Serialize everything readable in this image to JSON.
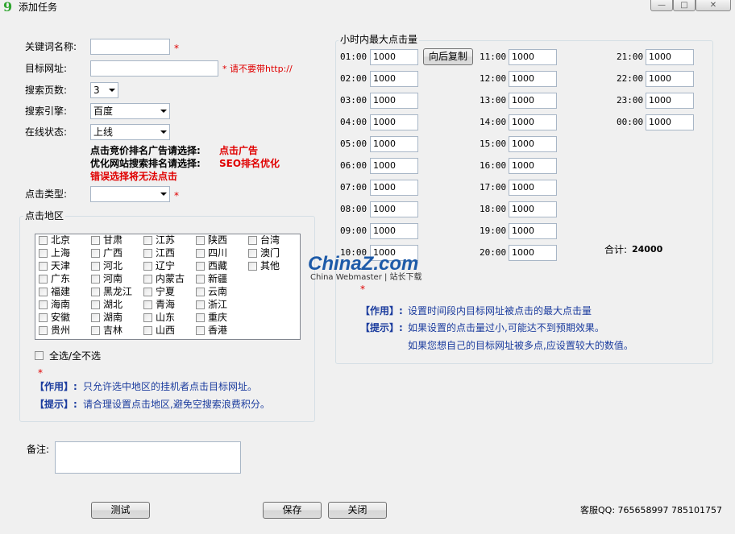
{
  "window": {
    "title": "添加任务",
    "app_icon_glyph": "9",
    "minimize_glyph": "—",
    "maximize_glyph": "□",
    "close_glyph": "✕"
  },
  "form": {
    "keyword_label": "关键词名称:",
    "keyword_value": "",
    "keyword_required": "*",
    "url_label": "目标网址:",
    "url_value": "",
    "url_hint": "* 请不要带http://",
    "pages_label": "搜索页数:",
    "pages_value": "3",
    "engine_label": "搜索引擎:",
    "engine_value": "百度",
    "status_label": "在线状态:",
    "status_value": "上线",
    "note1_prefix": "点击竞价排名广告请选择:",
    "note1_value": "点击广告",
    "note2_prefix": "优化网站搜索排名请选择:",
    "note2_value": "SEO排名优化",
    "note3": "错误选择将无法点击",
    "click_type_label": "点击类型:",
    "click_type_value": "",
    "click_type_required": "*"
  },
  "region": {
    "title": "点击地区",
    "columns": [
      [
        "北京",
        "上海",
        "天津",
        "广东",
        "福建",
        "海南",
        "安徽",
        "贵州"
      ],
      [
        "甘肃",
        "广西",
        "河北",
        "河南",
        "黑龙江",
        "湖北",
        "湖南",
        "吉林"
      ],
      [
        "江苏",
        "江西",
        "辽宁",
        "内蒙古",
        "宁夏",
        "青海",
        "山东",
        "山西"
      ],
      [
        "陕西",
        "四川",
        "西藏",
        "新疆",
        "云南",
        "浙江",
        "重庆",
        "香港"
      ],
      [
        "台湾",
        "澳门",
        "其他"
      ]
    ],
    "select_all_label": "全选/全不选",
    "required_mark": "*",
    "effect_tag": "【作用】:",
    "effect_text": "只允许选中地区的挂机者点击目标网址。",
    "tip_tag": "【提示】:",
    "tip_text": "请合理设置点击地区,避免空搜索浪费积分。"
  },
  "hourly": {
    "title": "小时内最大点击量",
    "copy_button": "向后复制",
    "hours": [
      {
        "time": "01:00",
        "value": "1000"
      },
      {
        "time": "02:00",
        "value": "1000"
      },
      {
        "time": "03:00",
        "value": "1000"
      },
      {
        "time": "04:00",
        "value": "1000"
      },
      {
        "time": "05:00",
        "value": "1000"
      },
      {
        "time": "06:00",
        "value": "1000"
      },
      {
        "time": "07:00",
        "value": "1000"
      },
      {
        "time": "08:00",
        "value": "1000"
      },
      {
        "time": "09:00",
        "value": "1000"
      },
      {
        "time": "10:00",
        "value": "1000"
      },
      {
        "time": "11:00",
        "value": "1000"
      },
      {
        "time": "12:00",
        "value": "1000"
      },
      {
        "time": "13:00",
        "value": "1000"
      },
      {
        "time": "14:00",
        "value": "1000"
      },
      {
        "time": "15:00",
        "value": "1000"
      },
      {
        "time": "16:00",
        "value": "1000"
      },
      {
        "time": "17:00",
        "value": "1000"
      },
      {
        "time": "18:00",
        "value": "1000"
      },
      {
        "time": "19:00",
        "value": "1000"
      },
      {
        "time": "20:00",
        "value": "1000"
      },
      {
        "time": "21:00",
        "value": "1000"
      },
      {
        "time": "22:00",
        "value": "1000"
      },
      {
        "time": "23:00",
        "value": "1000"
      },
      {
        "time": "00:00",
        "value": "1000"
      }
    ],
    "total_label": "合计:",
    "total_value": "24000",
    "required_mark": "*",
    "effect_tag": "【作用】:",
    "effect_text": "设置时间段内目标网址被点击的最大点击量",
    "tip_tag": "【提示】:",
    "tip_text1": "如果设置的点击量过小,可能达不到预期效果。",
    "tip_text2": "如果您想自己的目标网址被多点,应设置较大的数值。"
  },
  "watermark": {
    "brand": "ChinaZ.com",
    "sub": "China Webmaster | 站长下载"
  },
  "remark": {
    "label": "备注:",
    "value": ""
  },
  "buttons": {
    "test": "测试",
    "save": "保存",
    "close": "关闭"
  },
  "support": "客服QQ: 765658997 785101757",
  "colors": {
    "required_red": "#e00000",
    "hint_blue": "#1b3c9e",
    "background": "#f0f0f0"
  }
}
